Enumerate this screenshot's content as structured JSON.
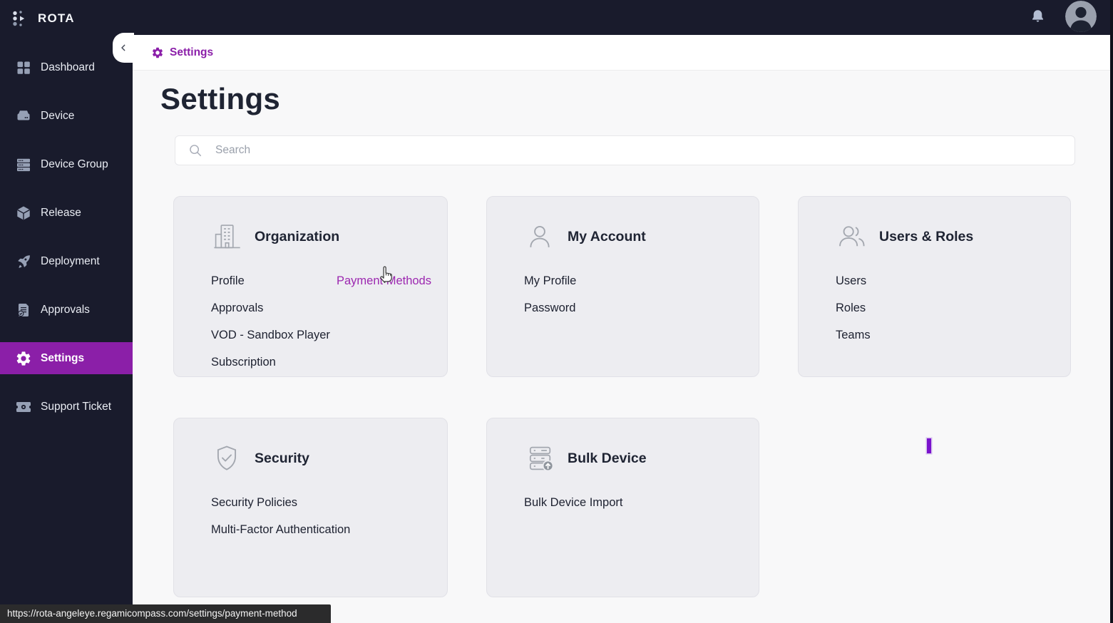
{
  "app": {
    "name": "ROTA"
  },
  "topbar": {
    "bell_icon": "notification-bell",
    "avatar_icon": "user-avatar"
  },
  "sidebar": {
    "items": [
      {
        "label": "Dashboard",
        "icon": "dashboard-icon",
        "active": false
      },
      {
        "label": "Device",
        "icon": "device-icon",
        "active": false
      },
      {
        "label": "Device Group",
        "icon": "device-group-icon",
        "active": false
      },
      {
        "label": "Release",
        "icon": "release-icon",
        "active": false
      },
      {
        "label": "Deployment",
        "icon": "deployment-icon",
        "active": false
      },
      {
        "label": "Approvals",
        "icon": "approvals-icon",
        "active": false
      },
      {
        "label": "Settings",
        "icon": "settings-gear-icon",
        "active": true
      },
      {
        "label": "Support Ticket",
        "icon": "support-ticket-icon",
        "active": false
      }
    ]
  },
  "breadcrumb": {
    "label": "Settings"
  },
  "page": {
    "title": "Settings"
  },
  "search": {
    "placeholder": "Search"
  },
  "cards": [
    {
      "title": "Organization",
      "icon": "building-icon",
      "items_left": [
        "Profile",
        "Approvals",
        "VOD - Sandbox Player",
        "Subscription"
      ],
      "items_right": [
        "Payment Methods"
      ],
      "highlighted_item": "Payment Methods"
    },
    {
      "title": "My Account",
      "icon": "person-icon",
      "items": [
        "My Profile",
        "Password"
      ]
    },
    {
      "title": "Users & Roles",
      "icon": "people-icon",
      "items": [
        "Users",
        "Roles",
        "Teams"
      ]
    },
    {
      "title": "Security",
      "icon": "shield-check-icon",
      "items": [
        "Security Policies",
        "Multi-Factor Authentication"
      ]
    },
    {
      "title": "Bulk Device",
      "icon": "server-import-icon",
      "items": [
        "Bulk Device Import"
      ]
    }
  ],
  "status_tooltip": {
    "url": "https://rota-angeleye.regamicompass.com/settings/payment-method"
  },
  "cursor": {
    "type": "hand-pointer",
    "caret_visible": true
  },
  "colors": {
    "accent_purple": "#8b1fa8",
    "link_purple": "#9c27b0",
    "sidebar_bg": "#191b2c",
    "caret_purple": "#7a12cd",
    "page_bg": "#f8f8f9",
    "card_bg": "#ededf1"
  }
}
